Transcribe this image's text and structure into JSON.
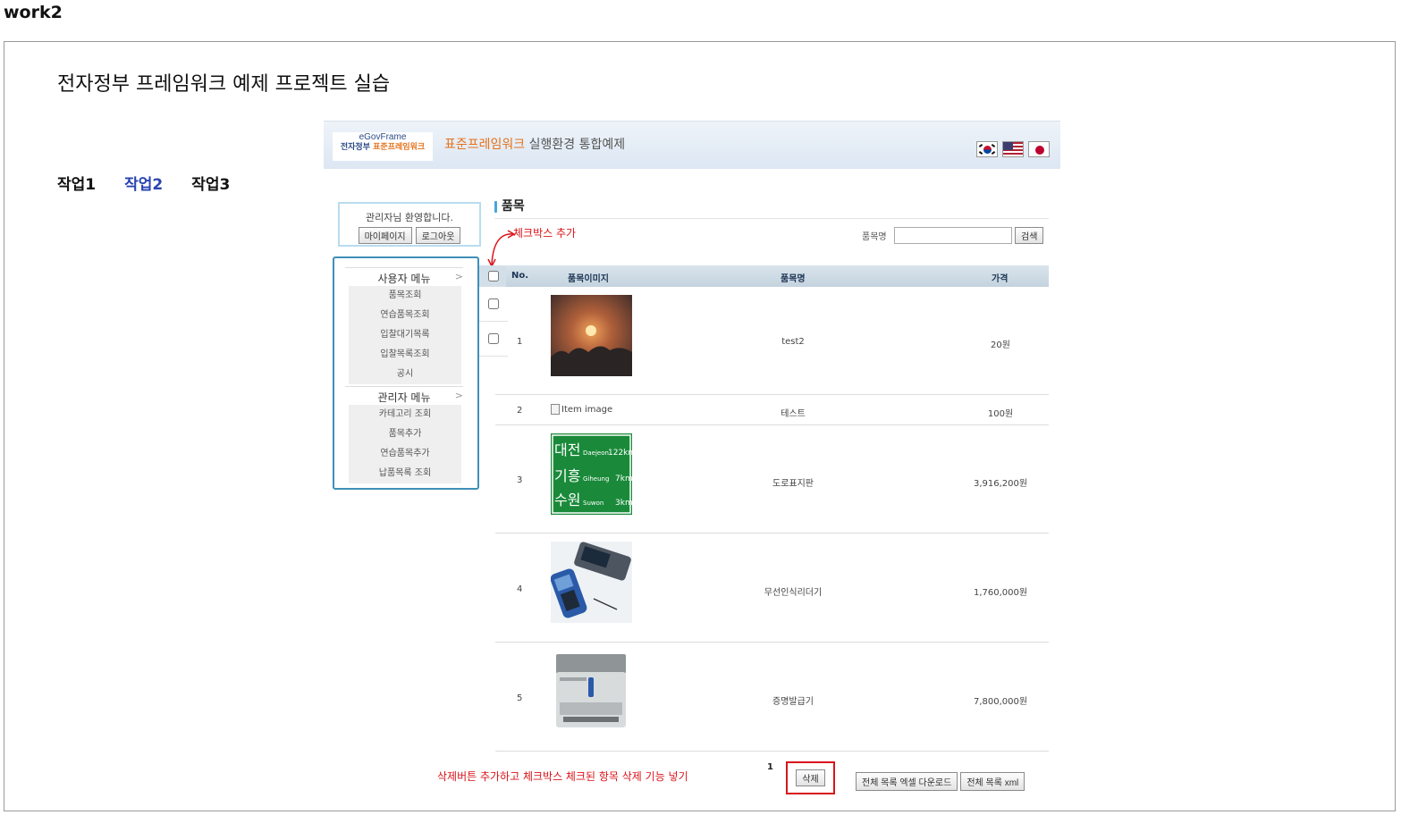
{
  "page": {
    "heading": "work2",
    "main_title": "전자정부 프레임워크 예제 프로젝트 실습",
    "work_tabs": [
      "작업1",
      "작업2",
      "작업3"
    ],
    "active_tab": "작업2"
  },
  "banner": {
    "logo_top": "eGovFrame",
    "logo_bottom_prefix": "전자정부 ",
    "logo_bottom_highlight": "표준프레임워크",
    "title_highlight": "표준프레임워크",
    "title_rest": " 실행환경 통합예제",
    "flags": [
      "korea-flag-icon",
      "usa-flag-icon",
      "japan-flag-icon"
    ]
  },
  "welcome": {
    "text": "관리자님 환영합니다.",
    "mypage_label": "마이페이지",
    "logout_label": "로그아웃"
  },
  "menu": {
    "user_title": "사용자 메뉴",
    "user_items": [
      "품목조회",
      "연습품목조회",
      "입찰대기목록",
      "입찰목록조회",
      "공시"
    ],
    "admin_title": "관리자 메뉴",
    "admin_items": [
      "카테고리 조회",
      "품목추가",
      "연습품목추가",
      "납품목록 조회"
    ]
  },
  "content": {
    "section_title": "품목",
    "annotation_checkbox": "체크박스 추가",
    "search_label": "품목명",
    "search_value": "",
    "search_button": "검색",
    "columns": {
      "no": "No.",
      "image": "품목이미지",
      "name": "품목명",
      "price": "가격"
    },
    "rows": [
      {
        "no": "1",
        "name": "test2",
        "price": "20원",
        "image": "sunset-photo"
      },
      {
        "no": "2",
        "name": "테스트",
        "price": "100원",
        "image": "broken",
        "image_alt": "Item image"
      },
      {
        "no": "3",
        "name": "도로표지판",
        "price": "3,916,200원",
        "image": "road-sign-photo"
      },
      {
        "no": "4",
        "name": "무선인식리더기",
        "price": "1,760,000원",
        "image": "rfid-reader-photo"
      },
      {
        "no": "5",
        "name": "증명발급기",
        "price": "7,800,000원",
        "image": "kiosk-printer-photo"
      }
    ],
    "road_sign": {
      "lines": [
        {
          "ko": "대전",
          "en": "Daejeon",
          "dist": "122km"
        },
        {
          "ko": "기흥",
          "en": "Giheung",
          "dist": "7km"
        },
        {
          "ko": "수원",
          "en": "Suwon",
          "dist": "3km"
        }
      ]
    },
    "pager": "1",
    "annotation_delete": "삭제버튼 추가하고 체크박스 체크된 항목 삭제 기능 넣기",
    "delete_button": "삭제",
    "excel_button": "전체 목록 엑셀 다운로드",
    "xml_button": "전체 목록 xml"
  },
  "colors": {
    "annotation": "#d9141a",
    "active_tab": "#2a44b0",
    "menu_border": "#3f8fb8",
    "welcome_border": "#b9dcef",
    "sign_green": "#1a8a3a"
  }
}
